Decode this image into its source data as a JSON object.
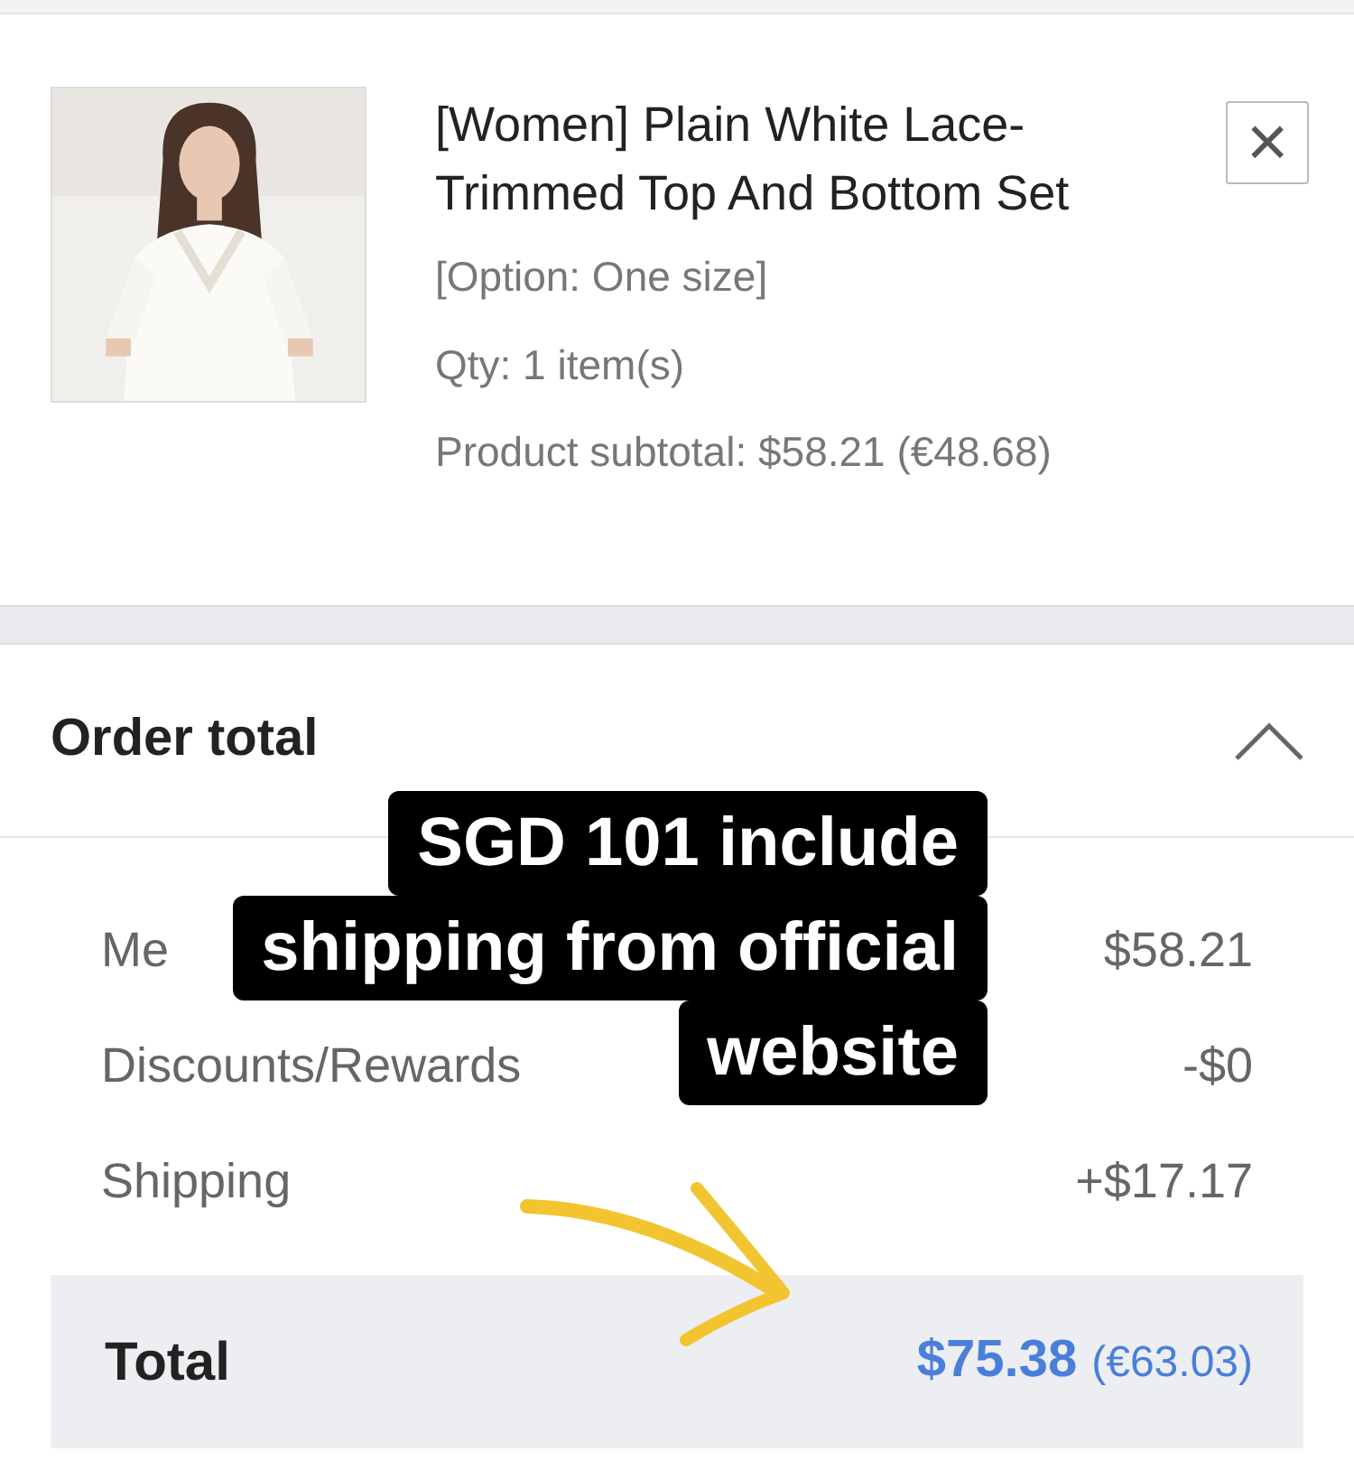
{
  "product": {
    "title": "[Women] Plain White Lace-Trimmed Top And Bottom Set",
    "option": "[Option: One size]",
    "qty": "Qty: 1 item(s)",
    "subtotal": "Product subtotal: $58.21 (€48.68)",
    "remove": "×"
  },
  "order_total": {
    "title": "Order total",
    "expanded": true,
    "rows": [
      {
        "label": "Me",
        "value": "$58.21"
      },
      {
        "label": "Discounts/Rewards",
        "value": "-$0"
      },
      {
        "label": "Shipping",
        "value": "+$17.17"
      }
    ],
    "total": {
      "label": "Total",
      "value": "$75.38",
      "secondary": "(€63.03)"
    }
  },
  "caption": [
    "SGD 101 include",
    "shipping from official",
    "website"
  ]
}
